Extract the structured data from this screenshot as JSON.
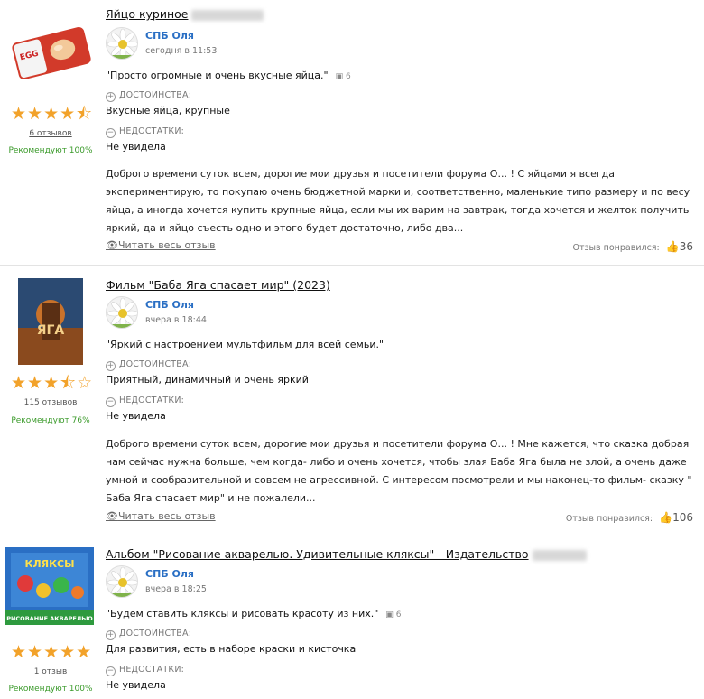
{
  "reviews": [
    {
      "title": "Яйцо куриное",
      "rating_stars": "★★★★⯪",
      "rating": 4.5,
      "reviews_count": "6 отзывов",
      "recommend": "Рекомендуют 100%",
      "author": "СПБ Оля",
      "time": "сегодня в 11:53",
      "quote": "\"Просто огромные и очень вкусные яйца.\"",
      "photos": "6",
      "pros_label": "ДОСТОИНСТВА:",
      "pros": "Вкусные яйца, крупные",
      "cons_label": "НЕДОСТАТКИ:",
      "cons": "Не увидела",
      "body": "Доброго времени суток всем, дорогие мои друзья и посетители форума О... ! С яйцами я всегда экспериментирую, то покупаю очень бюджетной марки и, соответственно, маленькие типо размеру и по весу яйца, а иногда хочется купить крупные яйца, если мы их варим на завтрак, тогда хочется и желток получить яркий, да и яйцо съесть одно и этого будет достаточно, либо два...",
      "read_more": "Читать весь отзыв",
      "liked_label": "Отзыв понравился:",
      "likes": "36"
    },
    {
      "title": "Фильм \"Баба Яга спасает мир\" (2023)",
      "rating_stars": "★★★⯪☆",
      "rating": 3.5,
      "reviews_count": "115 отзывов",
      "recommend": "Рекомендуют 76%",
      "author": "СПБ Оля",
      "time": "вчера в 18:44",
      "quote": "\"Яркий с настроением мультфильм для всей семьи.\"",
      "pros_label": "ДОСТОИНСТВА:",
      "pros": "Приятный, динамичный и очень яркий",
      "cons_label": "НЕДОСТАТКИ:",
      "cons": "Не увидела",
      "body": "Доброго времени суток всем, дорогие мои друзья и посетители форума О... ! Мне кажется, что сказка добрая нам сейчас нужна больше, чем когда- либо и очень хочется, чтобы злая Баба Яга была не злой, а очень даже умной и сообразительной и совсем не агрессивной. С интересом посмотрели и мы наконец-то фильм- сказку \" Баба Яга спасает мир\" и не пожалели...",
      "read_more": "Читать весь отзыв",
      "liked_label": "Отзыв понравился:",
      "likes": "106"
    },
    {
      "title": "Альбом \"Рисование акварелью. Удивительные кляксы\" - Издательство",
      "rating_stars": "★★★★★",
      "rating": 5,
      "reviews_count": "1 отзыв",
      "recommend": "Рекомендуют 100%",
      "author": "СПБ Оля",
      "time": "вчера в 18:25",
      "quote": "\"Будем ставить кляксы и рисовать красоту из них.\"",
      "photos": "6",
      "pros_label": "ДОСТОИНСТВА:",
      "pros": "Для развития, есть в наборе краски и кисточка",
      "cons_label": "НЕДОСТАТКИ:",
      "cons": "Не увидела"
    }
  ],
  "album_cover_text": {
    "top": "КЛЯКСЫ",
    "bottom": "РИСОВАНИЕ АКВАРЕЛЬЮ"
  },
  "colors": {
    "star": "#f2a22a",
    "author": "#2a6fc4",
    "recommend": "#3a9a2a"
  }
}
